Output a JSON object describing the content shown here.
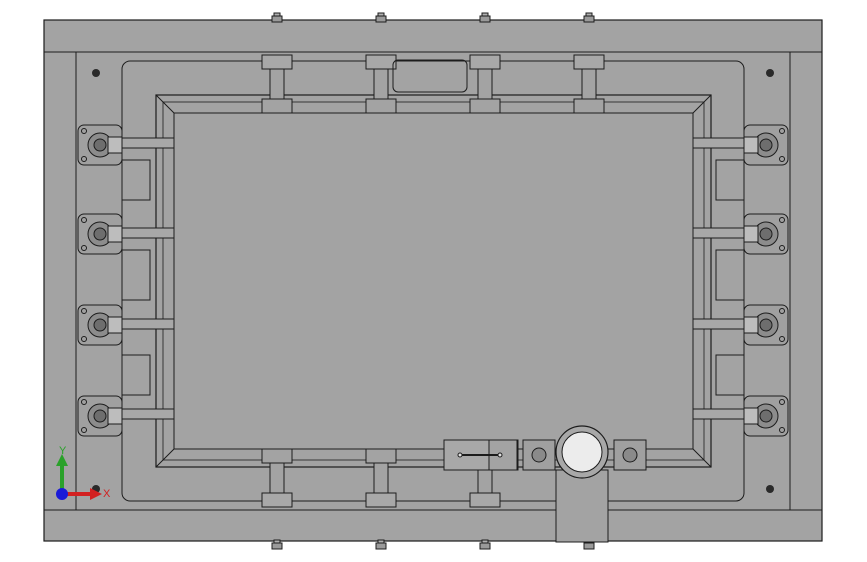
{
  "viewport": {
    "background": "#ffffff",
    "part_fill": "#a3a3a3",
    "edge_color": "#1c1c1c"
  },
  "triad": {
    "y_label": "Y",
    "x_label": "X",
    "y_color": "#2aa12a",
    "x_color": "#d22020",
    "z_color": "#1a1ad8"
  }
}
